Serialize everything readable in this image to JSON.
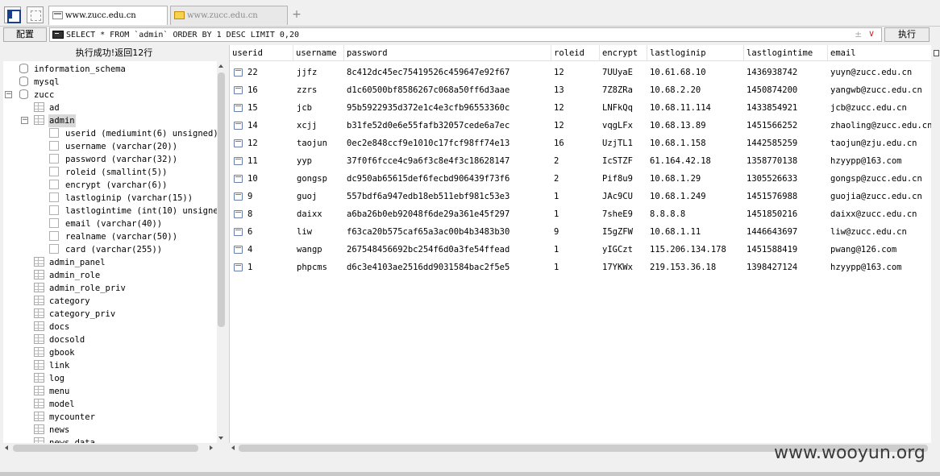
{
  "tabs": [
    {
      "label": "www.zucc.edu.cn",
      "active": true
    },
    {
      "label": "www.zucc.edu.cn",
      "active": false
    }
  ],
  "toolbar": {
    "config_label": "配置",
    "sql_value": "SELECT * FROM `admin` ORDER BY 1 DESC LIMIT 0,20",
    "plusminus": "±",
    "chevron": "∨",
    "execute_label": "执行"
  },
  "status_text": "执行成功!返回12行",
  "tree": {
    "databases": [
      "information_schema",
      "mysql",
      "zucc"
    ],
    "zucc_tables_before": [
      "ad"
    ],
    "selected_table": "admin",
    "admin_columns": [
      "userid (mediumint(6) unsigned)",
      "username (varchar(20))",
      "password (varchar(32))",
      "roleid (smallint(5))",
      "encrypt (varchar(6))",
      "lastloginip (varchar(15))",
      "lastlogintime (int(10) unsigned)",
      "email (varchar(40))",
      "realname (varchar(50))",
      "card (varchar(255))"
    ],
    "zucc_tables_after": [
      "admin_panel",
      "admin_role",
      "admin_role_priv",
      "category",
      "category_priv",
      "docs",
      "docsold",
      "gbook",
      "link",
      "log",
      "menu",
      "model",
      "mycounter",
      "news",
      "news_data"
    ]
  },
  "grid": {
    "columns": [
      "userid",
      "username",
      "password",
      "roleid",
      "encrypt",
      "lastloginip",
      "lastlogintime",
      "email"
    ],
    "rows": [
      [
        "22",
        "jjfz",
        "8c412dc45ec75419526c459647e92f67",
        "12",
        "7UUyaE",
        "10.61.68.10",
        "1436938742",
        "yuyn@zucc.edu.cn"
      ],
      [
        "16",
        "zzrs",
        "d1c60500bf8586267c068a50ff6d3aae",
        "13",
        "7Z8ZRa",
        "10.68.2.20",
        "1450874200",
        "yangwb@zucc.edu.cn"
      ],
      [
        "15",
        "jcb",
        "95b5922935d372e1c4e3cfb96553360c",
        "12",
        "LNFkQq",
        "10.68.11.114",
        "1433854921",
        "jcb@zucc.edu.cn"
      ],
      [
        "14",
        "xcjj",
        "b31fe52d0e6e55fafb32057cede6a7ec",
        "12",
        "vqgLFx",
        "10.68.13.89",
        "1451566252",
        "zhaoling@zucc.edu.cn"
      ],
      [
        "12",
        "taojun",
        "0ec2e848ccf9e1010c17fcf98ff74e13",
        "16",
        "UzjTL1",
        "10.68.1.158",
        "1442585259",
        "taojun@zju.edu.cn"
      ],
      [
        "11",
        "yyp",
        "37f0f6fcce4c9a6f3c8e4f3c18628147",
        "2",
        "IcSTZF",
        "61.164.42.18",
        "1358770138",
        "hzyypp@163.com"
      ],
      [
        "10",
        "gongsp",
        "dc950ab65615def6fecbd906439f73f6",
        "2",
        "Pif8u9",
        "10.68.1.29",
        "1305526633",
        "gongsp@zucc.edu.cn"
      ],
      [
        "9",
        "guoj",
        "557bdf6a947edb18eb511ebf981c53e3",
        "1",
        "JAc9CU",
        "10.68.1.249",
        "1451576988",
        "guojia@zucc.edu.cn"
      ],
      [
        "8",
        "daixx",
        "a6ba26b0eb92048f6de29a361e45f297",
        "1",
        "7sheE9",
        "8.8.8.8",
        "1451850216",
        "daixx@zucc.edu.cn"
      ],
      [
        "6",
        "liw",
        "f63ca20b575caf65a3ac00b4b3483b30",
        "9",
        "I5gZFW",
        "10.68.1.11",
        "1446643697",
        "liw@zucc.edu.cn"
      ],
      [
        "4",
        "wangp",
        "267548456692bc254f6d0a3fe54ffead",
        "1",
        "yIGCzt",
        "115.206.134.178",
        "1451588419",
        "pwang@126.com"
      ],
      [
        "1",
        "phpcms",
        "d6c3e4103ae2516dd9031584bac2f5e5",
        "1",
        "17YKWx",
        "219.153.36.18",
        "1398427124",
        "hzyypp@163.com"
      ]
    ]
  },
  "watermark": "www.wooyun.org"
}
